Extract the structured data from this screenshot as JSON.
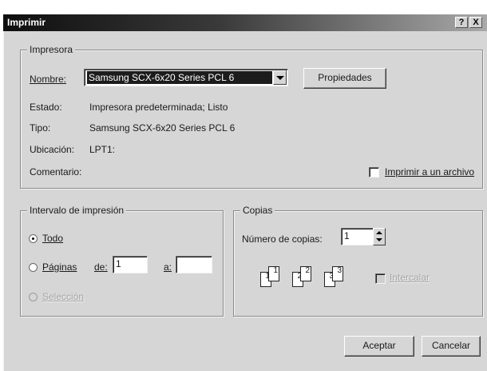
{
  "window": {
    "title": "Imprimir",
    "help_glyph": "?",
    "close_glyph": "X"
  },
  "printer": {
    "legend": "Impresora",
    "name_label": "Nombre:",
    "name_value": "Samsung SCX-6x20 Series PCL 6",
    "properties_button": "Propiedades",
    "status_label": "Estado:",
    "status_value": "Impresora predeterminada; Listo",
    "type_label": "Tipo:",
    "type_value": "Samsung SCX-6x20 Series PCL 6",
    "location_label": "Ubicación:",
    "location_value": "LPT1:",
    "comment_label": "Comentario:",
    "print_to_file_label": "Imprimir a un archivo",
    "print_to_file_checked": false
  },
  "range": {
    "legend": "Intervalo de impresión",
    "all_label": "Todo",
    "pages_label": "Páginas",
    "from_label": "de:",
    "from_value": "1",
    "to_label": "a:",
    "to_value": "",
    "selection_label": "Selección",
    "selected": "all"
  },
  "copies": {
    "legend": "Copias",
    "count_label": "Número de copias:",
    "count_value": "1",
    "collate_label": "Intercalar",
    "collate_enabled": false,
    "collate_icon_numbers": [
      "1",
      "1",
      "2",
      "2",
      "3",
      "3"
    ]
  },
  "buttons": {
    "ok": "Aceptar",
    "cancel": "Cancelar"
  }
}
